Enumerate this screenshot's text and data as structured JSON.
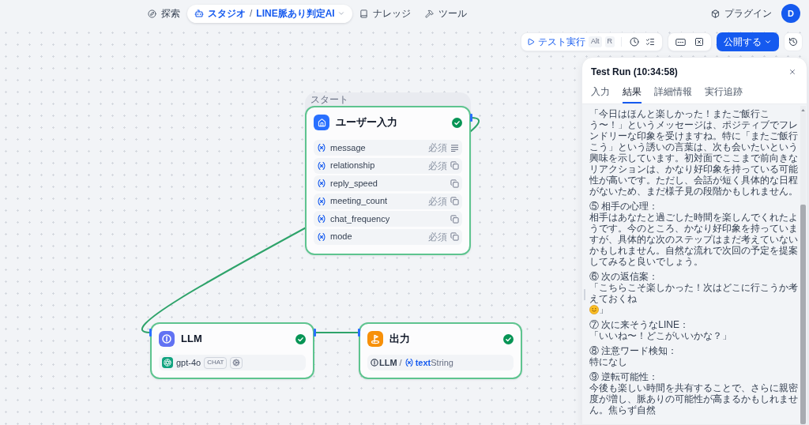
{
  "top_nav": {
    "items": [
      {
        "label": "探索",
        "selected": false
      },
      {
        "label": "スタジオ",
        "separator": "/",
        "app_name": "LINE脈あり判定AI",
        "selected": true
      },
      {
        "label": "ナレッジ",
        "selected": false
      },
      {
        "label": "ツール",
        "selected": false
      }
    ],
    "plugins": "プラグイン",
    "avatar": "D"
  },
  "toolbar": {
    "run": {
      "label": "テスト実行",
      "keys": [
        "Alt",
        "R"
      ]
    },
    "publish": "公開する"
  },
  "canvas": {
    "nodes": [
      {
        "kind": "start",
        "group_label": "スタート",
        "title": "ユーザー入力",
        "succeeded": true,
        "fields": [
          {
            "name": "message",
            "badge": "必須",
            "kind": "paragraph"
          },
          {
            "name": "relationship",
            "badge": "必須",
            "kind": "select"
          },
          {
            "name": "reply_speed",
            "kind": "select"
          },
          {
            "name": "meeting_count",
            "badge": "必須",
            "kind": "select"
          },
          {
            "name": "chat_frequency",
            "kind": "select"
          },
          {
            "name": "mode",
            "badge": "必須",
            "kind": "select"
          }
        ]
      },
      {
        "kind": "llm",
        "title": "LLM",
        "succeeded": true,
        "model": "gpt-4o",
        "mode": "CHAT"
      },
      {
        "kind": "end",
        "title": "出力",
        "succeeded": true,
        "output": {
          "node": "LLM",
          "separator": "/",
          "variable": "text",
          "type": "String"
        }
      }
    ]
  },
  "test_run": {
    "title": "Test Run (10:34:58)",
    "tabs": [
      {
        "label": "入力",
        "selected": false
      },
      {
        "label": "結果",
        "selected": true
      },
      {
        "label": "詳細情報",
        "selected": false
      },
      {
        "label": "実行追跡",
        "selected": false
      }
    ],
    "sections": [
      {
        "text": "「今日はほんと楽しかった！またご飯行こう〜！」というメッセージは、ポジティブでフレンドリーな印象を受けますね。特に「またご飯行こう」という誘いの言葉は、次も会いたいという興味を示しています。初対面でここまで前向きなリアクションは、かなり好印象を持っている可能性が高いです。ただし、会話が短く具体的な日程がないため、まだ様子見の段階かもしれません。"
      },
      {
        "heading": "⑤ 相手の心理：",
        "text": "相手はあなたと過ごした時間を楽しんでくれたようです。今のところ、かなり好印象を持っていますが、具体的な次のステップはまだ考えていないかもしれません。自然な流れで次回の予定を提案してみると良いでしょう。"
      },
      {
        "heading": "⑥ 次の返信案：",
        "text": "「こちらこそ楽しかった！次はどこに行こうか考えておくね",
        "after_emoji": "」"
      },
      {
        "heading": "⑦ 次に来そうなLINE：",
        "text": "「いいね〜！どこがいいかな？」"
      },
      {
        "heading": "⑧ 注意ワード検知：",
        "text": "特になし"
      },
      {
        "heading": "⑨ 逆転可能性：",
        "text": "今後も楽しい時間を共有することで、さらに親密度が増し、脈ありの可能性が高まるかもしれません。焦らず自然"
      }
    ]
  }
}
